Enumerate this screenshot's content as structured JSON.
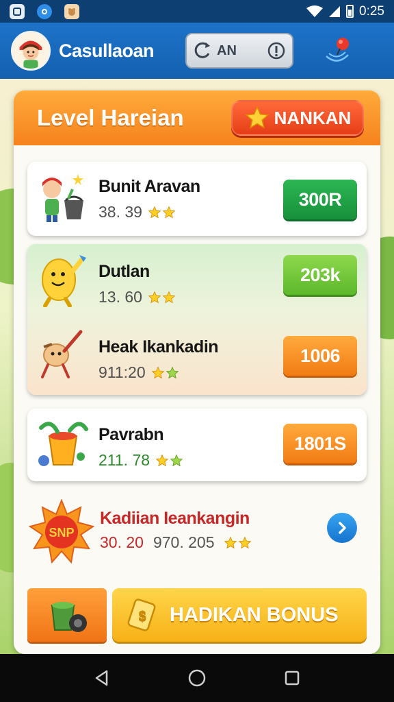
{
  "status_bar": {
    "time": "0:25",
    "icons": [
      "app-notification-icon",
      "app-notification-icon",
      "app-notification-icon",
      "wifi-icon",
      "signal-icon",
      "battery-icon"
    ]
  },
  "header": {
    "app_title": "Casullaoan",
    "pill_label": "AN",
    "colors": {
      "bar": "#1460b0"
    }
  },
  "panel": {
    "title": "Level Hareian",
    "rank_button": "NANKAN",
    "tasks": [
      {
        "title": "Bunit Aravan",
        "meta": "38. 39",
        "reward": "300R",
        "color": "#17903b"
      },
      {
        "title": "Dutlan",
        "meta": "13. 60",
        "reward": "203k",
        "color": "#5cb82b"
      },
      {
        "title": "Heak Ikankadin",
        "meta": "911:20",
        "reward": "1006",
        "color": "#f27b14"
      },
      {
        "title": "Pavrabn",
        "meta": "211. 78",
        "reward": "1801S",
        "color": "#f27b14"
      }
    ],
    "special": {
      "badge": "SNP",
      "title": "Kadiian Ieankangin",
      "meta_value": "30. 20",
      "meta_sub": "970. 205"
    },
    "bonus_button": "HADIKAN BONUS"
  },
  "nav": {
    "icons": [
      "back-icon",
      "home-icon",
      "recents-icon"
    ]
  }
}
